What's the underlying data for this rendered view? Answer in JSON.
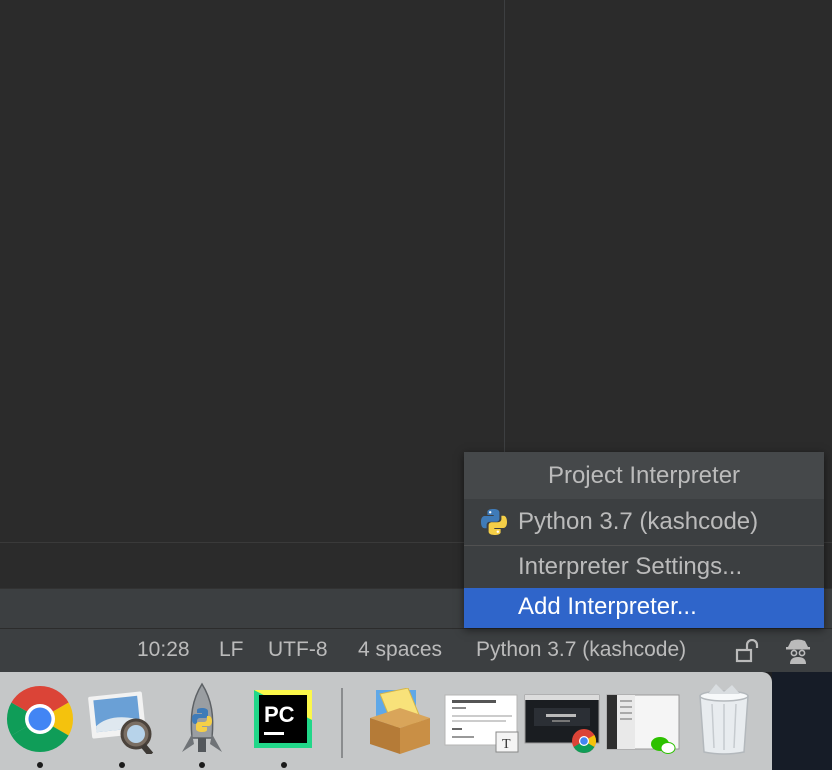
{
  "popup": {
    "title": "Project Interpreter",
    "interpreter_option": "Python 3.7 (kashcode)",
    "settings_item": "Interpreter Settings...",
    "add_item": "Add Interpreter..."
  },
  "statusbar": {
    "position": "10:28",
    "line_separator": "LF",
    "encoding": "UTF-8",
    "indent": "4 spaces",
    "interpreter": "Python 3.7 (kashcode)",
    "lock_icon": "unlock-icon",
    "inspector_icon": "hector-icon"
  },
  "dock": {
    "items": [
      "chrome-icon",
      "preview-icon",
      "python-launcher-icon",
      "pycharm-icon",
      "downloads-stack-icon",
      "document-thumbnail",
      "chrome-window-thumbnail",
      "wechat-window-thumbnail",
      "trash-icon"
    ],
    "pycharm_letters": "PC"
  }
}
